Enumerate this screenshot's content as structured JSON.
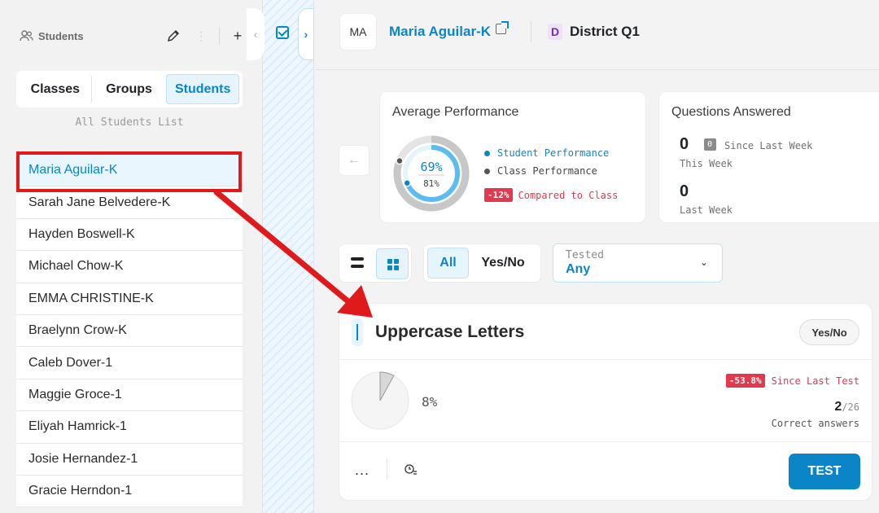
{
  "sidebar": {
    "title": "Students",
    "tabs": [
      {
        "label": "Classes"
      },
      {
        "label": "Groups"
      },
      {
        "label": "Students"
      }
    ],
    "list_caption": "All Students List",
    "students": [
      "Maria Aguilar-K",
      "Sarah Jane Belvedere-K",
      "Hayden Boswell-K",
      "Michael Chow-K",
      "EMMA CHRISTINE-K",
      "Braelynn Crow-K",
      "Caleb Dover-1",
      "Maggie Groce-1",
      "Eliyah Hamrick-1",
      "Josie Hernandez-1",
      "Gracie Herndon-1"
    ],
    "selected_student": "Maria Aguilar-K"
  },
  "header": {
    "avatar_initials": "MA",
    "student_name": "Maria Aguilar-K",
    "district_badge": "D",
    "district_name": "District Q1"
  },
  "performance": {
    "title": "Average Performance",
    "student_percent": "69%",
    "class_percent": "81%",
    "student_value": 69,
    "class_value": 81,
    "legend_student": "Student Performance",
    "legend_class": "Class Performance",
    "compare_badge": "-12%",
    "compare_text": "Compared to Class"
  },
  "questions": {
    "title": "Questions Answered",
    "this_week_value": "0",
    "since_badge": "0",
    "since_text": "Since Last Week",
    "this_week_label": "This Week",
    "last_week_value": "0",
    "last_week_label": "Last Week"
  },
  "filters": {
    "type_all": "All",
    "type_yesno": "Yes/No",
    "tested_label": "Tested",
    "tested_value": "Any"
  },
  "skill": {
    "title": "Uppercase Letters",
    "type_badge": "Yes/No",
    "percent": "8%",
    "percent_value": 8,
    "since_badge": "-53.8%",
    "since_text": "Since Last Test",
    "correct": "2",
    "total": "/26",
    "correct_label": "Correct answers",
    "test_button": "TEST",
    "more_label": "..."
  },
  "colors": {
    "accent": "#0a86c8",
    "negative": "#e2394f",
    "annotation": "#e01a1a"
  }
}
